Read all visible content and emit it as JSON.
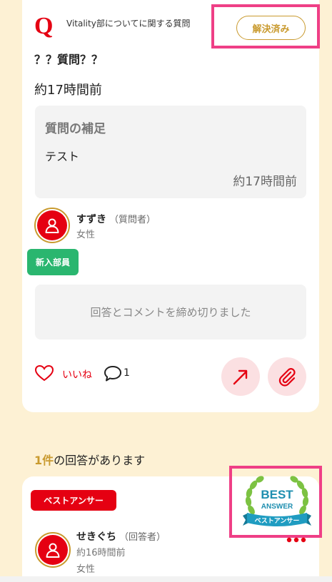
{
  "question": {
    "mark": "Q",
    "category": "Vitality部についてに関する質問",
    "status_button": "解決済み",
    "title": "？？質問？？",
    "time": "約17時間前",
    "supplement": {
      "heading": "質問の補足",
      "body": "テスト",
      "time": "約17時間前"
    },
    "asker": {
      "name": "すずき",
      "role": "（質問者）",
      "gender": "女性",
      "badge": "新入部員"
    },
    "closed_message": "回答とコメントを締め切りました",
    "actions": {
      "like_label": "いいね",
      "comment_count": "1"
    }
  },
  "answers_header": {
    "count": "1件",
    "suffix": "の回答があります"
  },
  "answer": {
    "best_tag": "ベストアンサー",
    "badge": {
      "line1": "BEST",
      "line2": "ANSWER",
      "ribbon": "ベストアンサー"
    },
    "answerer": {
      "name": "せきぐち",
      "role": "（回答者）",
      "time": "約16時間前",
      "gender": "女性"
    }
  },
  "colors": {
    "accent_red": "#e50012",
    "gold": "#c99a2e",
    "new_member_green": "#2ab66f",
    "highlight_pink": "#ef3f86",
    "page_bg": "#fdf1d4"
  },
  "icons": [
    "like-heart-icon",
    "comment-bubble-icon",
    "share-arrow-icon",
    "paperclip-icon",
    "user-icon",
    "more-dots-icon",
    "best-answer-laurel-icon"
  ]
}
